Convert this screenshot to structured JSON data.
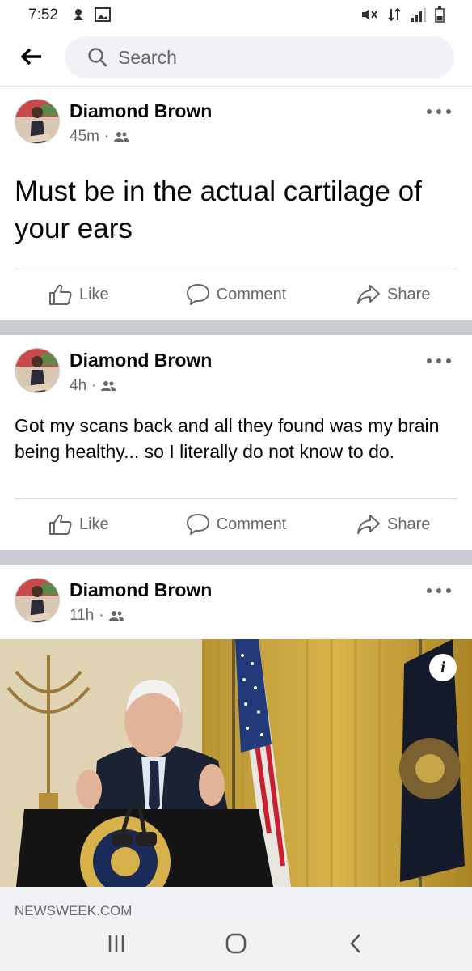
{
  "status_bar": {
    "time": "7:52"
  },
  "search": {
    "placeholder": "Search"
  },
  "posts": [
    {
      "author": "Diamond Brown",
      "time": "45m",
      "text": "Must be in the actual cartilage of your ears"
    },
    {
      "author": "Diamond Brown",
      "time": "4h",
      "text": "Got my scans back and all they found was my brain being healthy... so I literally do not know to do."
    },
    {
      "author": "Diamond Brown",
      "time": "11h",
      "link_domain": "NEWSWEEK.COM"
    }
  ],
  "actions": {
    "like": "Like",
    "comment": "Comment",
    "share": "Share"
  },
  "icons": [
    "back-arrow-icon",
    "search-icon",
    "audience-friends-icon",
    "like-icon",
    "comment-icon",
    "share-icon",
    "more-icon",
    "info-icon",
    "recent-apps-icon",
    "home-icon",
    "nav-back-icon"
  ],
  "colors": {
    "secondary_text": "#65676b",
    "separator": "#c9ccd1",
    "search_bg": "#f0f2f5"
  }
}
